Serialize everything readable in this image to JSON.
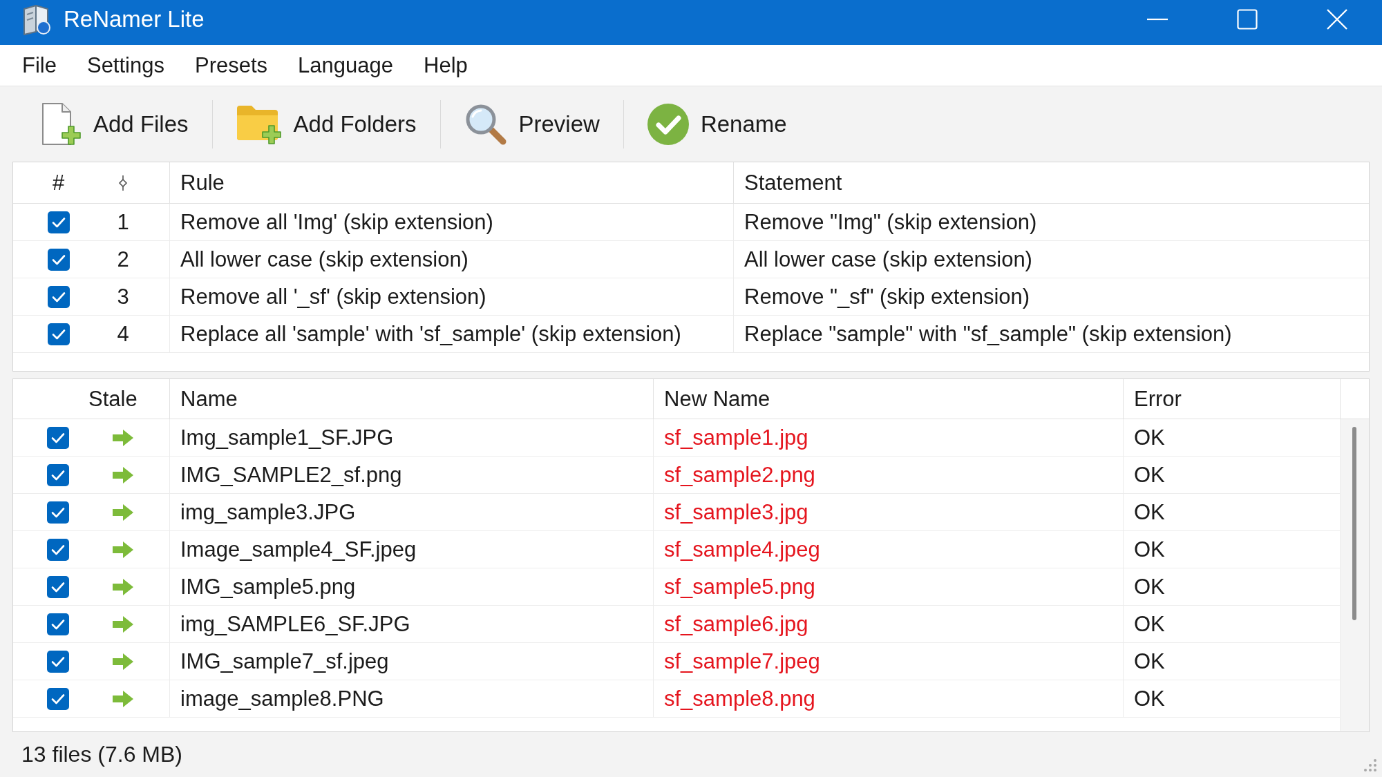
{
  "window": {
    "title": "ReNamer Lite"
  },
  "menu": [
    "File",
    "Settings",
    "Presets",
    "Language",
    "Help"
  ],
  "toolbar": [
    {
      "kind": "add_files",
      "label": "Add Files"
    },
    {
      "kind": "add_folders",
      "label": "Add Folders"
    },
    {
      "kind": "preview",
      "label": "Preview"
    },
    {
      "kind": "rename",
      "label": "Rename"
    }
  ],
  "rules_table": {
    "columns": [
      {
        "kind": "text",
        "label": "#"
      },
      {
        "kind": "icon"
      },
      {
        "kind": "text",
        "label": "Rule"
      },
      {
        "kind": "text",
        "label": "Statement"
      }
    ],
    "rows": [
      {
        "checked": true,
        "number": "1",
        "rule": "Remove all 'Img' (skip extension)",
        "statement": "Remove \"Img\" (skip extension)"
      },
      {
        "checked": true,
        "number": "2",
        "rule": "All lower case (skip extension)",
        "statement": "All lower case (skip extension)"
      },
      {
        "checked": true,
        "number": "3",
        "rule": "Remove all '_sf' (skip extension)",
        "statement": "Remove \"_sf\" (skip extension)"
      },
      {
        "checked": true,
        "number": "4",
        "rule": "Replace all 'sample' with 'sf_sample' (skip extension)",
        "statement": "Replace \"sample\" with \"sf_sample\" (skip extension)"
      }
    ]
  },
  "files_table": {
    "columns": [
      "Stale",
      "Name",
      "New Name",
      "Error"
    ],
    "rows": [
      {
        "checked": true,
        "stale": true,
        "name": "Img_sample1_SF.JPG",
        "new_name": "sf_sample1.jpg",
        "error": "OK"
      },
      {
        "checked": true,
        "stale": true,
        "name": "IMG_SAMPLE2_sf.png",
        "new_name": "sf_sample2.png",
        "error": "OK"
      },
      {
        "checked": true,
        "stale": true,
        "name": "img_sample3.JPG",
        "new_name": "sf_sample3.jpg",
        "error": "OK"
      },
      {
        "checked": true,
        "stale": true,
        "name": "Image_sample4_SF.jpeg",
        "new_name": "sf_sample4.jpeg",
        "error": "OK"
      },
      {
        "checked": true,
        "stale": true,
        "name": "IMG_sample5.png",
        "new_name": "sf_sample5.png",
        "error": "OK"
      },
      {
        "checked": true,
        "stale": true,
        "name": "img_SAMPLE6_SF.JPG",
        "new_name": "sf_sample6.jpg",
        "error": "OK"
      },
      {
        "checked": true,
        "stale": true,
        "name": "IMG_sample7_sf.jpeg",
        "new_name": "sf_sample7.jpeg",
        "error": "OK"
      },
      {
        "checked": true,
        "stale": true,
        "name": "image_sample8.PNG",
        "new_name": "sf_sample8.png",
        "error": "OK"
      }
    ]
  },
  "status_bar": {
    "text": "13 files (7.6 MB)"
  }
}
